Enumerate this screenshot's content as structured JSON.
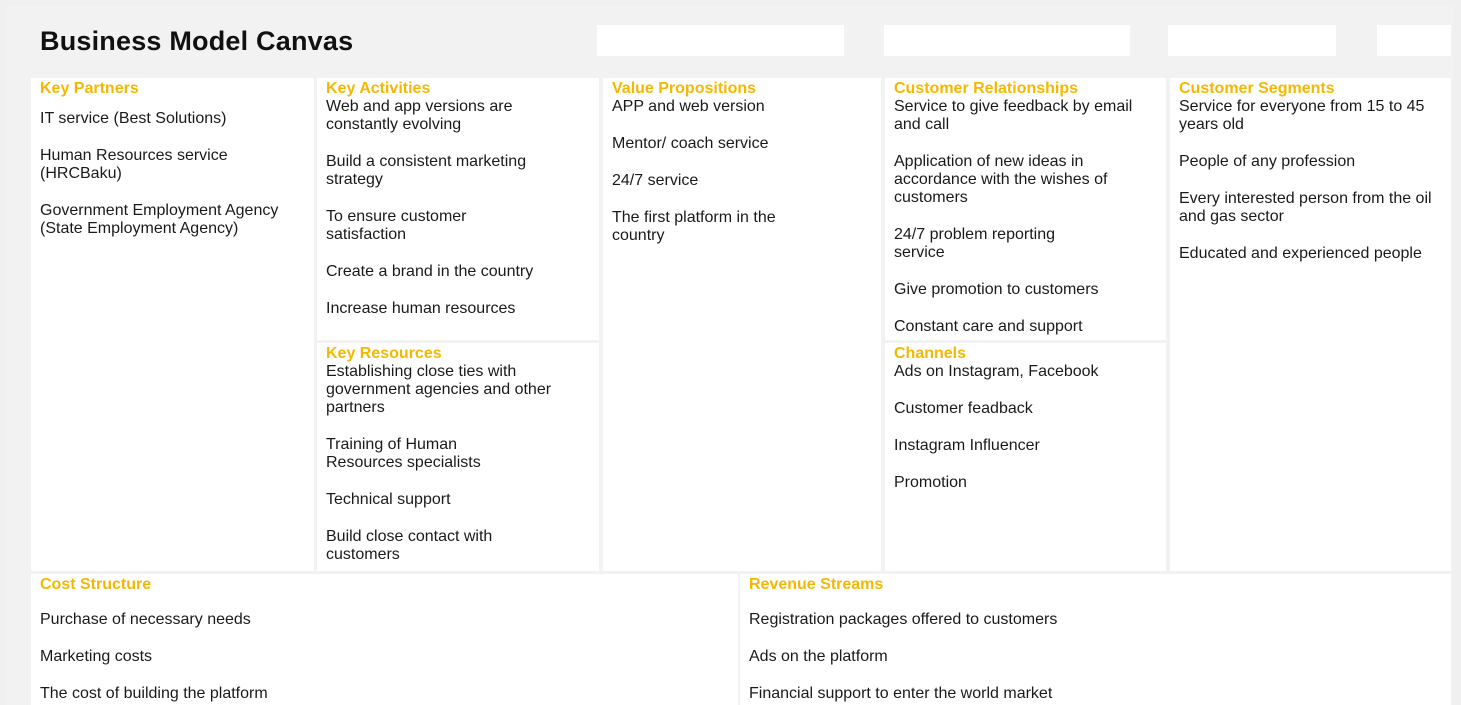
{
  "title": "Business Model Canvas",
  "sections": {
    "key_partners": {
      "heading": "Key Partners",
      "items": [
        " IT service (Best Solutions)",
        "Human Resources service (HRCBaku)",
        "Government Employment Agency (State Employment Agency)"
      ]
    },
    "key_activities": {
      "heading": "Key Activities",
      "items": [
        "Web and app versions are constantly evolving",
        "Build a consistent marketing strategy",
        "To ensure customer satisfaction",
        "Create a brand in the country",
        "Increase human resources"
      ]
    },
    "key_resources": {
      "heading": "Key Resources",
      "items": [
        "Establishing close ties with government agencies and other partners",
        "Training of Human Resources specialists",
        "Technical support",
        "Build close contact with customers"
      ]
    },
    "value_propositions": {
      "heading": "Value Propositions",
      "items": [
        "APP and web version",
        "Mentor/ coach service",
        " 24/7 service",
        "The first platform in the country"
      ]
    },
    "customer_relationships": {
      "heading": "Customer Relationships",
      "items": [
        "Service to give feedback by email and call",
        "Application of new ideas in accordance with the wishes of customers",
        "24/7 problem reporting service",
        "Give promotion to customers",
        "Constant care and support"
      ]
    },
    "channels": {
      "heading": "Channels",
      "items": [
        "Ads on Instagram, Facebook",
        "Customer feadback",
        "Instagram Influencer",
        "Promotion"
      ]
    },
    "customer_segments": {
      "heading": "Customer Segments",
      "items": [
        "Service for everyone from 15 to 45 years old",
        "People of any profession",
        "Every interested person from the oil and gas sector",
        "Educated and experienced people"
      ]
    },
    "cost_structure": {
      "heading": "Cost Structure",
      "items": [
        "Purchase of necessary needs",
        "Marketing costs",
        "The cost of building the platform"
      ]
    },
    "revenue_streams": {
      "heading": "Revenue Streams",
      "items": [
        "Registration packages offered to customers",
        "Ads on the platform",
        "Financial support to enter the world market"
      ]
    }
  },
  "colors": {
    "heading": "#f5b800",
    "background": "#f2f2f2",
    "cell": "#ffffff"
  }
}
